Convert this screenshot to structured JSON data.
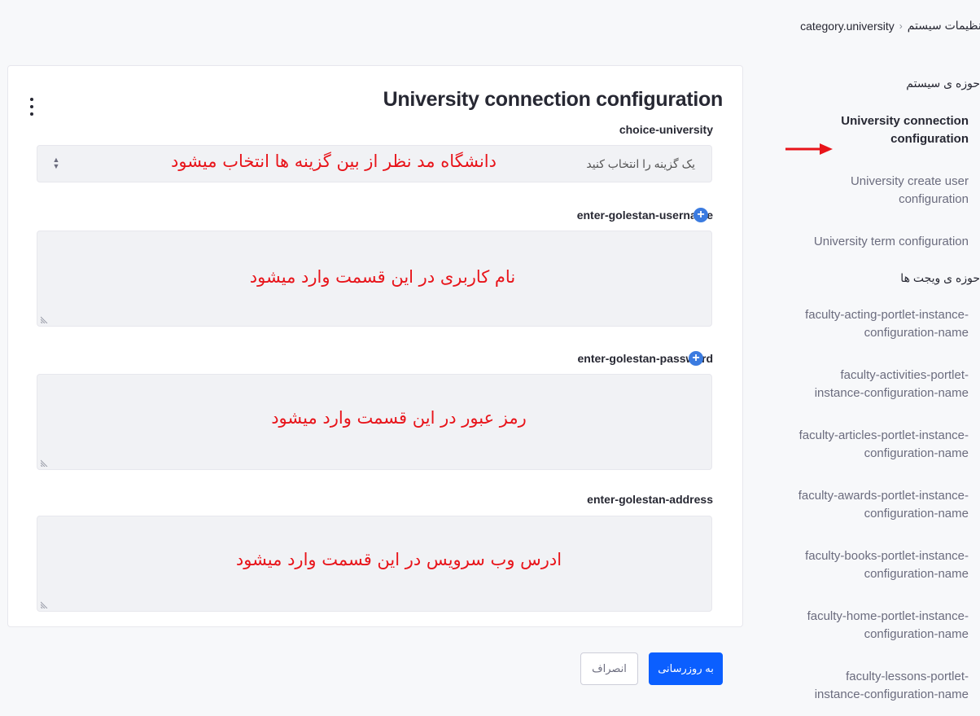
{
  "breadcrumb": {
    "root": "تنظیمات سیستم",
    "separator": "‹",
    "current": "category.university"
  },
  "sidebar": {
    "sections": [
      {
        "category": "حوزه ی سیستم",
        "items": [
          {
            "label": "University connection configuration",
            "active": true
          },
          {
            "label": "University create user configuration",
            "active": false
          },
          {
            "label": "University term configuration",
            "active": false
          }
        ]
      },
      {
        "category": "حوزه ی ویجت ها",
        "items": [
          {
            "label": "faculty-acting-portlet-instance-configuration-name"
          },
          {
            "label": "faculty-activities-portlet-instance-configuration-name"
          },
          {
            "label": "faculty-articles-portlet-instance-configuration-name"
          },
          {
            "label": "faculty-awards-portlet-instance-configuration-name"
          },
          {
            "label": "faculty-books-portlet-instance-configuration-name"
          },
          {
            "label": "faculty-home-portlet-instance-configuration-name"
          },
          {
            "label": "faculty-lessons-portlet-instance-configuration-name"
          }
        ]
      }
    ]
  },
  "form": {
    "title": "University connection configuration",
    "choice_label": "choice-university",
    "choice_placeholder": "یک گزینه را انتخاب کنید",
    "username_label": "enter-golestan-username",
    "password_label": "enter-golestan-password",
    "address_label": "enter-golestan-address"
  },
  "annotations": {
    "choice_note": "دانشگاه مد نظر از بین گزینه ها انتخاب میشود",
    "username_note": "نام کاربری در این قسمت وارد میشود",
    "password_note": "رمز عبور در این قسمت وارد میشود",
    "address_note": "ادرس وب سرویس در این قسمت وارد میشود"
  },
  "actions": {
    "update_label": "به روزرسانی",
    "cancel_label": "انصراف"
  },
  "colors": {
    "primary": "#0b5fff",
    "annotation_red": "#e8141a",
    "plus_badge": "#3b7be0"
  }
}
